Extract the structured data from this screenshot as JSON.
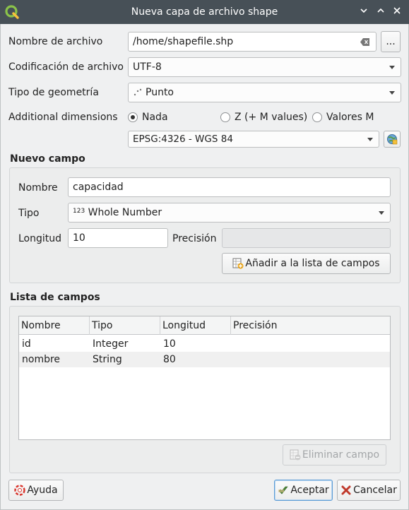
{
  "window": {
    "title": "Nueva capa de archivo shape",
    "logo_icon": "qgis-logo-icon",
    "controls": [
      "chevron-down-icon",
      "chevron-up-icon",
      "close-icon"
    ]
  },
  "file": {
    "label": "Nombre de archivo",
    "value": "/home/shapefile.shp",
    "browse_label": "..."
  },
  "encoding": {
    "label": "Codificación de archivo",
    "value": "UTF-8"
  },
  "geometry": {
    "label": "Tipo de geometría",
    "value": "Punto",
    "icon": "point-geometry-icon"
  },
  "dimensions": {
    "label": "Additional dimensions",
    "options": [
      "Nada",
      "Z (+ M values)",
      "Valores M"
    ],
    "selected": "Nada"
  },
  "crs": {
    "value": "EPSG:4326 - WGS 84",
    "select_icon": "crs-globe-icon"
  },
  "new_field": {
    "title": "Nuevo campo",
    "name_label": "Nombre",
    "name_value": "capacidad",
    "type_label": "Tipo",
    "type_prefix": "123",
    "type_value": "Whole Number",
    "length_label": "Longitud",
    "length_value": "10",
    "precision_label": "Precisión",
    "precision_value": "",
    "add_button": "Añadir a la lista de campos"
  },
  "field_list": {
    "title": "Lista de campos",
    "columns": [
      "Nombre",
      "Tipo",
      "Longitud",
      "Precisión"
    ],
    "rows": [
      [
        "id",
        "Integer",
        "10",
        ""
      ],
      [
        "nombre",
        "String",
        "80",
        ""
      ]
    ],
    "remove_button": "Eliminar campo"
  },
  "footer": {
    "help_button": "Ayuda",
    "ok_button": "Aceptar",
    "cancel_button": "Cancelar"
  },
  "colors": {
    "titlebar": "#475057",
    "dialog_bg": "#eff0f1",
    "focus_accent": "#5b9bd5",
    "help_icon": "#d9342b",
    "cancel_icon": "#c0392b",
    "ok_icon": "#4e8a3a"
  }
}
